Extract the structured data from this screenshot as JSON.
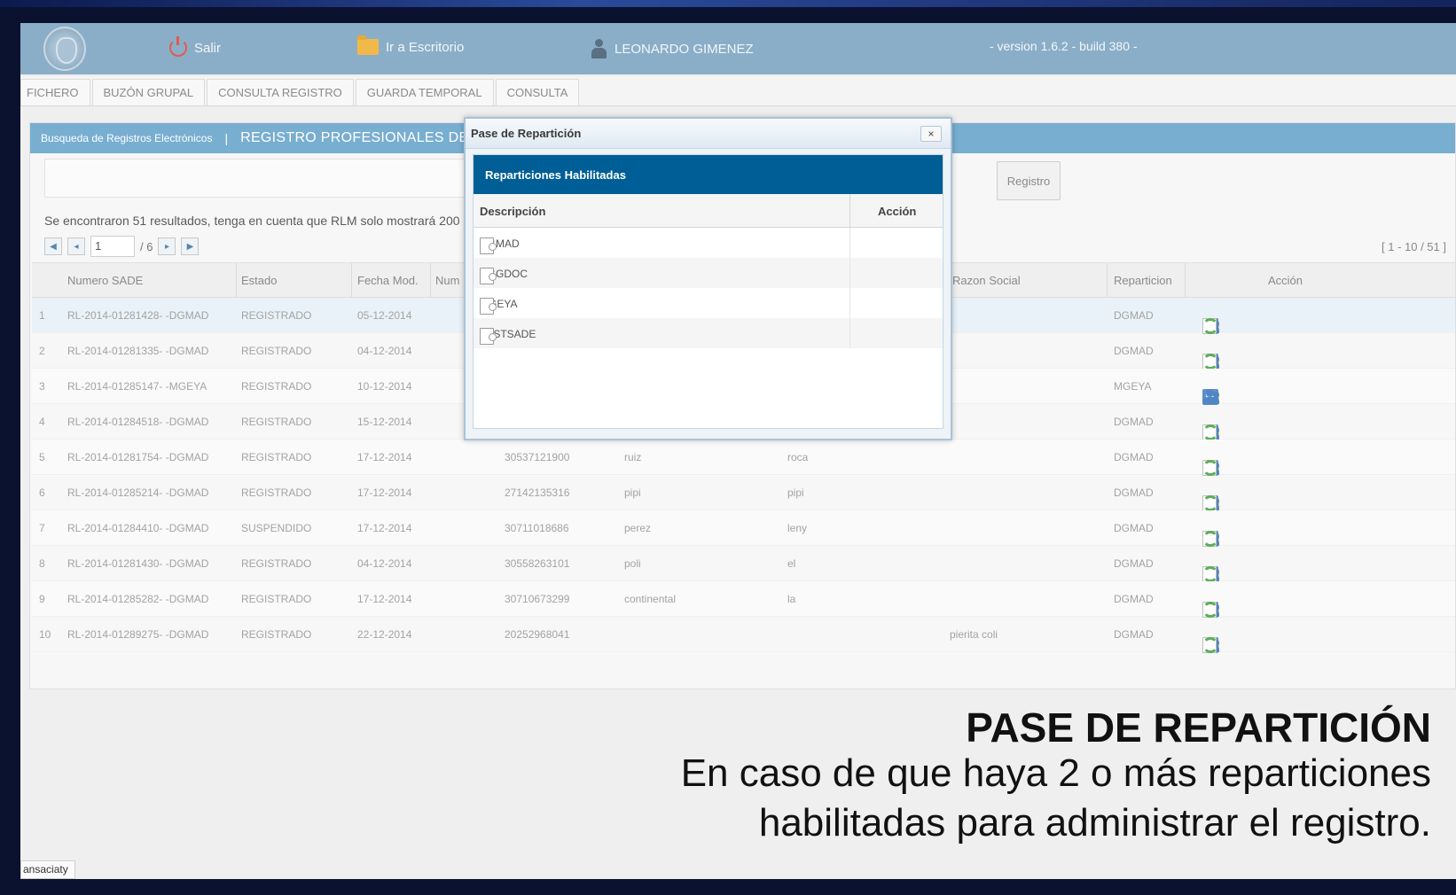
{
  "header": {
    "exit_label": "Salir",
    "desktop_label": "Ir a Escritorio",
    "user_name": "LEONARDO GIMENEZ",
    "version": "- version 1.6.2 - build 380 -"
  },
  "tabs": [
    {
      "label": "FICHERO"
    },
    {
      "label": "BUZÓN GRUPAL"
    },
    {
      "label": "CONSULTA REGISTRO"
    },
    {
      "label": "GUARDA TEMPORAL"
    },
    {
      "label": "CONSULTA"
    }
  ],
  "panel": {
    "breadcrumb": "Busqueda de Registros Electrónicos",
    "separator": "|",
    "title": "REGISTRO PROFESIONALES DE",
    "register_button": "Registro",
    "results_text": "Se encontraron 51 resultados, tenga en cuenta que RLM solo mostrará 200 res",
    "pager": {
      "page": "1",
      "total": "/ 6",
      "range": "[ 1 - 10 / 51 ]"
    }
  },
  "table": {
    "columns": {
      "numero": "Numero SADE",
      "estado": "Estado",
      "fecha": "Fecha Mod.",
      "num": "Num",
      "razon": "Razon Social",
      "reparticion": "Reparticion",
      "accion": "Acción"
    },
    "rows": [
      {
        "n": "1",
        "sade": "RL-2014-01281428- -DGMAD",
        "estado": "REGISTRADO",
        "fecha": "05-12-2014",
        "cuit": "",
        "nombre": "",
        "apellido": "",
        "razon": "",
        "rep": "DGMAD"
      },
      {
        "n": "2",
        "sade": "RL-2014-01281335- -DGMAD",
        "estado": "REGISTRADO",
        "fecha": "04-12-2014",
        "cuit": "",
        "nombre": "",
        "apellido": "",
        "razon": "",
        "rep": "DGMAD"
      },
      {
        "n": "3",
        "sade": "RL-2014-01285147- -MGEYA",
        "estado": "REGISTRADO",
        "fecha": "10-12-2014",
        "cuit": "",
        "nombre": "",
        "apellido": "",
        "razon": "",
        "rep": "MGEYA"
      },
      {
        "n": "4",
        "sade": "RL-2014-01284518- -DGMAD",
        "estado": "REGISTRADO",
        "fecha": "15-12-2014",
        "cuit": "",
        "nombre": "",
        "apellido": "",
        "razon": "",
        "rep": "DGMAD"
      },
      {
        "n": "5",
        "sade": "RL-2014-01281754- -DGMAD",
        "estado": "REGISTRADO",
        "fecha": "17-12-2014",
        "cuit": "30537121900",
        "nombre": "ruiz",
        "apellido": "roca",
        "razon": "",
        "rep": "DGMAD"
      },
      {
        "n": "6",
        "sade": "RL-2014-01285214- -DGMAD",
        "estado": "REGISTRADO",
        "fecha": "17-12-2014",
        "cuit": "27142135316",
        "nombre": "pipi",
        "apellido": "pipi",
        "razon": "",
        "rep": "DGMAD"
      },
      {
        "n": "7",
        "sade": "RL-2014-01284410- -DGMAD",
        "estado": "SUSPENDIDO",
        "fecha": "17-12-2014",
        "cuit": "30711018686",
        "nombre": "perez",
        "apellido": "leny",
        "razon": "",
        "rep": "DGMAD"
      },
      {
        "n": "8",
        "sade": "RL-2014-01281430- -DGMAD",
        "estado": "REGISTRADO",
        "fecha": "04-12-2014",
        "cuit": "30558263101",
        "nombre": "poli",
        "apellido": "el",
        "razon": "",
        "rep": "DGMAD"
      },
      {
        "n": "9",
        "sade": "RL-2014-01285282- -DGMAD",
        "estado": "REGISTRADO",
        "fecha": "17-12-2014",
        "cuit": "30710673299",
        "nombre": "continental",
        "apellido": "la",
        "razon": "",
        "rep": "DGMAD"
      },
      {
        "n": "10",
        "sade": "RL-2014-01289275- -DGMAD",
        "estado": "REGISTRADO",
        "fecha": "22-12-2014",
        "cuit": "20252968041",
        "nombre": "",
        "apellido": "",
        "razon": "pierita coli",
        "rep": "DGMAD"
      }
    ]
  },
  "modal": {
    "title": "Pase de Repartición",
    "close": "×",
    "band": "Reparticiones Habilitadas",
    "col_desc": "Descripción",
    "col_accion": "Acción",
    "rows": [
      {
        "desc": "DGMAD"
      },
      {
        "desc": "DGGDOC"
      },
      {
        "desc": "MGEYA"
      },
      {
        "desc": "TESTSADE"
      }
    ]
  },
  "caption": {
    "title": "PASE DE REPARTICIÓN",
    "line1": "En caso de que haya 2 o más reparticiones",
    "line2": "habilitadas para administrar el registro."
  },
  "statusbar": "ansaciaty"
}
